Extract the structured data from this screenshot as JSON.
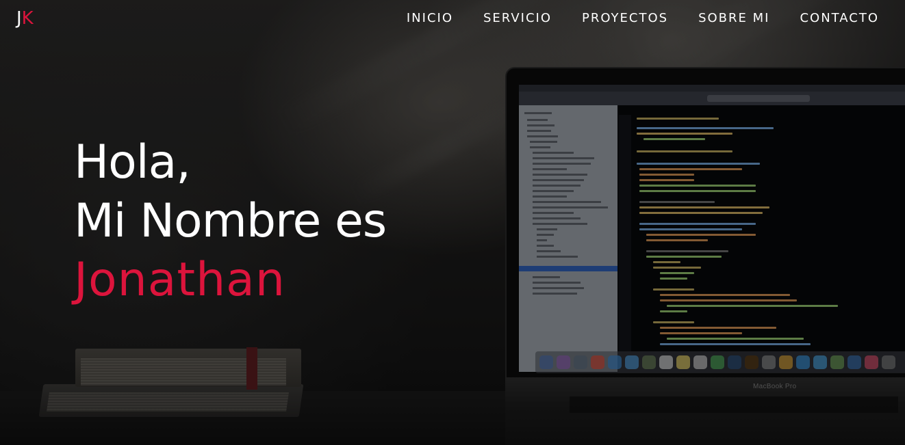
{
  "logo": {
    "first": "J",
    "second": "K",
    "colors": {
      "first": "#ffffff",
      "second": "#dc143c"
    }
  },
  "nav": {
    "items": [
      {
        "label": "INICIO"
      },
      {
        "label": "SERVICIO"
      },
      {
        "label": "PROYECTOS"
      },
      {
        "label": "SOBRE MI"
      },
      {
        "label": "CONTACTO"
      }
    ]
  },
  "hero": {
    "line1": "Hola,",
    "line2": "Mi Nombre es",
    "name": "Jonathan",
    "accent_color": "#dc143c"
  },
  "background": {
    "laptop_brand": "MacBook Pro"
  }
}
